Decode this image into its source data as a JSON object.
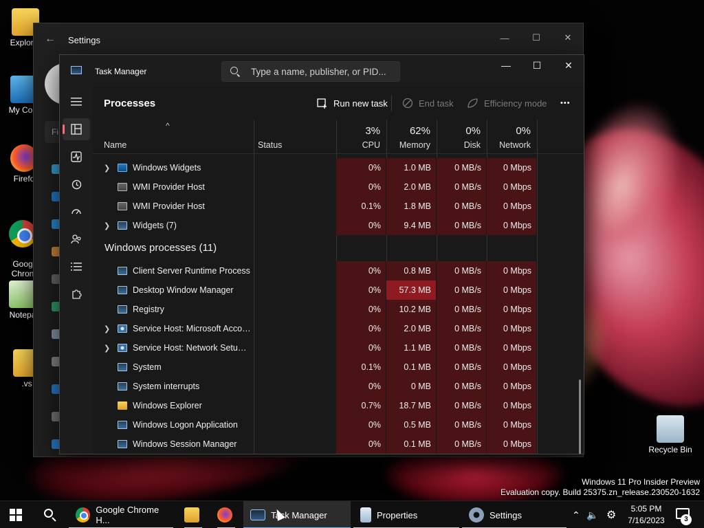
{
  "desktop": {
    "icons": [
      {
        "label": "Explorer"
      },
      {
        "label": "My Com"
      },
      {
        "label": "Firefo"
      },
      {
        "label": "Goog\nChron"
      },
      {
        "label": "Notepa"
      },
      {
        "label": ".vs"
      }
    ],
    "recycle_bin": "Recycle Bin",
    "watermark_line1": "Windows 11 Pro Insider Preview",
    "watermark_line2": "Evaluation copy. Build 25375.zn_release.230520-1632"
  },
  "settings": {
    "title": "Settings",
    "find_label": "Fi"
  },
  "taskmanager": {
    "title": "Task Manager",
    "search_placeholder": "Type a name, publisher, or PID...",
    "page_title": "Processes",
    "toolbar": {
      "run_new_task": "Run new task",
      "end_task": "End task",
      "efficiency_mode": "Efficiency mode",
      "more": "•••"
    },
    "columns": {
      "name": "Name",
      "status": "Status",
      "cpu": {
        "label": "CPU",
        "pct": "3%"
      },
      "memory": {
        "label": "Memory",
        "pct": "62%"
      },
      "disk": {
        "label": "Disk",
        "pct": "0%"
      },
      "network": {
        "label": "Network",
        "pct": "0%"
      }
    },
    "apps_rows": [
      {
        "name": "Windows Widgets",
        "expandable": true,
        "icon": "widget",
        "cpu": "0%",
        "mem": "1.0 MB",
        "disk": "0 MB/s",
        "net": "0 Mbps"
      },
      {
        "name": "WMI Provider Host",
        "expandable": false,
        "icon": "wmi",
        "cpu": "0%",
        "mem": "2.0 MB",
        "disk": "0 MB/s",
        "net": "0 Mbps"
      },
      {
        "name": "WMI Provider Host",
        "expandable": false,
        "icon": "wmi",
        "cpu": "0.1%",
        "mem": "1.8 MB",
        "disk": "0 MB/s",
        "net": "0 Mbps"
      },
      {
        "name": "Widgets (7)",
        "expandable": true,
        "icon": "window",
        "cpu": "0%",
        "mem": "9.4 MB",
        "disk": "0 MB/s",
        "net": "0 Mbps"
      }
    ],
    "windows_group": "Windows processes (11)",
    "windows_rows": [
      {
        "name": "Client Server Runtime Process",
        "expandable": false,
        "icon": "window",
        "cpu": "0%",
        "mem": "0.8 MB",
        "disk": "0 MB/s",
        "net": "0 Mbps"
      },
      {
        "name": "Desktop Window Manager",
        "expandable": false,
        "icon": "window",
        "cpu": "0%",
        "mem": "57.3 MB",
        "disk": "0 MB/s",
        "net": "0 Mbps",
        "mem_hot": true
      },
      {
        "name": "Registry",
        "expandable": false,
        "icon": "window",
        "cpu": "0%",
        "mem": "10.2 MB",
        "disk": "0 MB/s",
        "net": "0 Mbps"
      },
      {
        "name": "Service Host: Microsoft Accou...",
        "expandable": true,
        "icon": "gear",
        "cpu": "0%",
        "mem": "2.0 MB",
        "disk": "0 MB/s",
        "net": "0 Mbps"
      },
      {
        "name": "Service Host: Network Setup S...",
        "expandable": true,
        "icon": "gear",
        "cpu": "0%",
        "mem": "1.1 MB",
        "disk": "0 MB/s",
        "net": "0 Mbps"
      },
      {
        "name": "System",
        "expandable": false,
        "icon": "window",
        "cpu": "0.1%",
        "mem": "0.1 MB",
        "disk": "0 MB/s",
        "net": "0 Mbps"
      },
      {
        "name": "System interrupts",
        "expandable": false,
        "icon": "window",
        "cpu": "0%",
        "mem": "0 MB",
        "disk": "0 MB/s",
        "net": "0 Mbps"
      },
      {
        "name": "Windows Explorer",
        "expandable": false,
        "icon": "folder",
        "cpu": "0.7%",
        "mem": "18.7 MB",
        "disk": "0 MB/s",
        "net": "0 Mbps"
      },
      {
        "name": "Windows Logon Application",
        "expandable": false,
        "icon": "window",
        "cpu": "0%",
        "mem": "0.5 MB",
        "disk": "0 MB/s",
        "net": "0 Mbps"
      },
      {
        "name": "Windows Session Manager",
        "expandable": false,
        "icon": "window",
        "cpu": "0%",
        "mem": "0.1 MB",
        "disk": "0 MB/s",
        "net": "0 Mbps"
      }
    ],
    "colors": {
      "heat_low": "#4a1416",
      "heat_high": "#8e1a22",
      "accent": "#ff6a78"
    }
  },
  "taskbar": {
    "items": [
      {
        "label": "Google Chrome H...",
        "icon": "chrome-icon"
      },
      {
        "label": "Task Manager",
        "icon": "task-manager-icon"
      },
      {
        "label": "Properties",
        "icon": "properties-icon"
      },
      {
        "label": "Settings",
        "icon": "settings-icon"
      }
    ],
    "time": "5:05 PM",
    "date": "7/16/2023",
    "notification_count": "3"
  }
}
